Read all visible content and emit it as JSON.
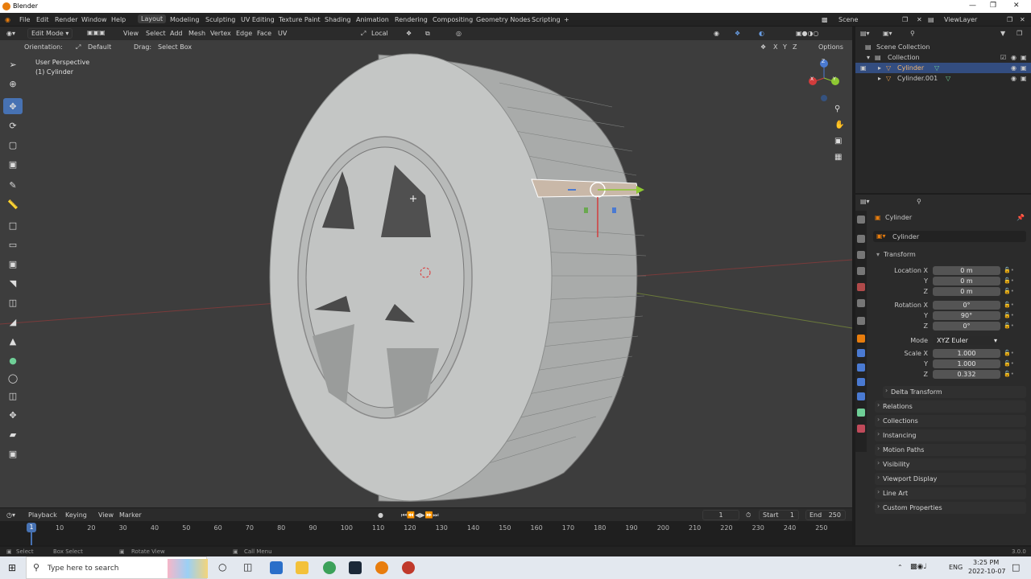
{
  "window": {
    "title": "Blender"
  },
  "menu": [
    "File",
    "Edit",
    "Render",
    "Window",
    "Help"
  ],
  "workspaces": [
    "Layout",
    "Modeling",
    "Sculpting",
    "UV Editing",
    "Texture Paint",
    "Shading",
    "Animation",
    "Rendering",
    "Compositing",
    "Geometry Nodes",
    "Scripting"
  ],
  "active_workspace": "Layout",
  "scene": {
    "label": "Scene",
    "view_layer": "ViewLayer"
  },
  "viewport_header": {
    "mode": "Edit Mode",
    "menus": [
      "View",
      "Select",
      "Add",
      "Mesh",
      "Vertex",
      "Edge",
      "Face",
      "UV"
    ],
    "transform": "Local",
    "orientation_label": "Orientation:",
    "orientation_value": "Default",
    "drag_label": "Drag:",
    "drag_value": "Select Box",
    "options": "Options",
    "axes": [
      "X",
      "Y",
      "Z"
    ]
  },
  "viewport": {
    "perspective": "User Perspective",
    "object": "(1) Cylinder"
  },
  "gizmo_axes": {
    "x": "X",
    "y": "Y",
    "z": "Z"
  },
  "outliner": {
    "scene_collection": "Scene Collection",
    "collection": "Collection",
    "items": [
      "Cylinder",
      "Cylinder.001"
    ]
  },
  "properties": {
    "object_name": "Cylinder",
    "data_name": "Cylinder",
    "transform_title": "Transform",
    "location": {
      "label": "Location X",
      "x": "0 m",
      "y": "0 m",
      "z": "0 m"
    },
    "rotation": {
      "label": "Rotation X",
      "x": "0°",
      "y": "90°",
      "z": "0°"
    },
    "mode": {
      "label": "Mode",
      "value": "XYZ Euler"
    },
    "scale": {
      "label": "Scale X",
      "x": "1.000",
      "y": "1.000",
      "z": "0.332"
    },
    "axis_y": "Y",
    "axis_z": "Z",
    "panels": [
      "Delta Transform",
      "Relations",
      "Collections",
      "Instancing",
      "Motion Paths",
      "Visibility",
      "Viewport Display",
      "Line Art",
      "Custom Properties"
    ]
  },
  "timeline": {
    "menus": [
      "Playback",
      "Keying",
      "View",
      "Marker"
    ],
    "current_frame": "1",
    "start_label": "Start",
    "start": "1",
    "end_label": "End",
    "end": "250",
    "frames": [
      "10",
      "20",
      "30",
      "40",
      "50",
      "60",
      "70",
      "80",
      "90",
      "100",
      "110",
      "120",
      "130",
      "140",
      "150",
      "160",
      "170",
      "180",
      "190",
      "200",
      "210",
      "220",
      "230",
      "240",
      "250"
    ],
    "playhead": "1"
  },
  "statusbar": {
    "items": [
      "Select",
      "Box Select",
      "Rotate View",
      "Call Menu"
    ],
    "version": "3.0.0"
  },
  "taskbar": {
    "search_placeholder": "Type here to search",
    "time": "3:25 PM",
    "date": "2022-10-07",
    "lang": "ENG"
  },
  "colors": {
    "accent": "#4772b3",
    "orange": "#e87d0d",
    "viewport_bg": "#3d3d3d"
  }
}
